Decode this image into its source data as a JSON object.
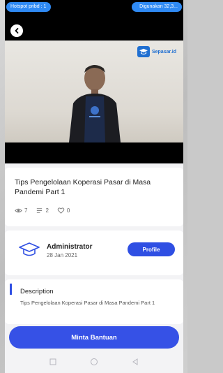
{
  "status_bar": {
    "hotspot_label": "Hotspot pribd : 1",
    "usage_label": "Digunakan 32,3..."
  },
  "video": {
    "brand_text": "Sepasar.id",
    "back_icon": "back-arrow-icon"
  },
  "content": {
    "title": "Tips Pengelolaan Koperasi Pasar di Masa Pandemi Part 1",
    "views": "7",
    "comments": "2",
    "likes": "0"
  },
  "author": {
    "name": "Administrator",
    "date": "28 Jan 2021",
    "profile_label": "Profile"
  },
  "description": {
    "heading": "Description",
    "text": "Tips Pengelolaan Koperasi Pasar di Masa Pandemi Part 1"
  },
  "actions": {
    "help_label": "Minta Bantuan"
  },
  "colors": {
    "accent": "#2f4fe3",
    "status_pill": "#2f8af4"
  }
}
